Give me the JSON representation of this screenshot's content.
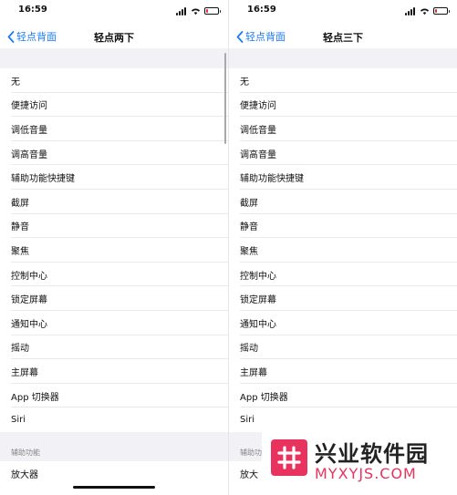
{
  "status_bar": {
    "time": "16:59"
  },
  "colors": {
    "accent": "#1a7cf5",
    "battery_low": "#e0322b",
    "watermark": "#e8335e"
  },
  "left_screen": {
    "back_label": "轻点背面",
    "title": "轻点两下",
    "items": [
      "无",
      "便捷访问",
      "调低音量",
      "调高音量",
      "辅助功能快捷键",
      "截屏",
      "静音",
      "聚焦",
      "控制中心",
      "锁定屏幕",
      "通知中心",
      "摇动",
      "主屏幕",
      "App 切换器",
      "Siri"
    ],
    "section_header": "辅助功能",
    "section_items": [
      "放大器"
    ]
  },
  "right_screen": {
    "back_label": "轻点背面",
    "title": "轻点三下",
    "items": [
      "无",
      "便捷访问",
      "调低音量",
      "调高音量",
      "辅助功能快捷键",
      "截屏",
      "静音",
      "聚焦",
      "控制中心",
      "锁定屏幕",
      "通知中心",
      "摇动",
      "主屏幕",
      "App 切换器",
      "Siri"
    ],
    "section_header": "辅助功能",
    "section_items": [
      "放大"
    ]
  },
  "watermark": {
    "title": "兴业软件园",
    "url": "MYXYJS.COM"
  }
}
